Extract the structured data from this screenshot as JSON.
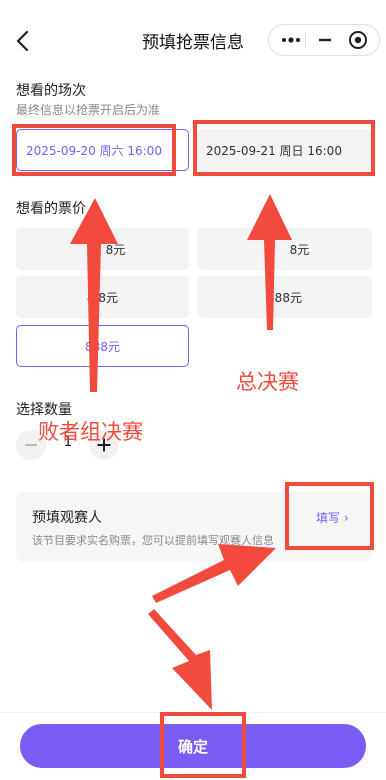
{
  "nav": {
    "title": "预填抢票信息",
    "back_icon": "chevron-left-icon",
    "capsule_icons": [
      "more-dots-icon",
      "minimize-icon",
      "close-target-icon"
    ]
  },
  "session": {
    "title": "想看的场次",
    "subtitle": "最终信息以抢票开启后为准",
    "options": [
      {
        "label": "2025-09-20 周六 16:00",
        "selected": true
      },
      {
        "label": "2025-09-21 周日 16:00",
        "selected": false
      }
    ]
  },
  "price": {
    "title": "想看的票价",
    "options": [
      {
        "label": "8元",
        "selected": false
      },
      {
        "label": "8元",
        "selected": false
      },
      {
        "label": "4 8元",
        "selected": false
      },
      {
        "label": "688元",
        "selected": false
      },
      {
        "label": "888元",
        "selected": true
      }
    ]
  },
  "quantity": {
    "title": "选择数量",
    "value": "1"
  },
  "spectator": {
    "title": "预填观赛人",
    "description": "该节目要求实名购票，您可以提前填写观赛人信息",
    "fill_label": "填写 ›"
  },
  "confirm_label": "确定",
  "annotations": {
    "losers_final": "败者组决赛",
    "grand_final": "总决赛"
  },
  "colors": {
    "accent": "#7a5cf4",
    "annotation": "#f24a3c",
    "option_bg": "#f3f3f3"
  }
}
